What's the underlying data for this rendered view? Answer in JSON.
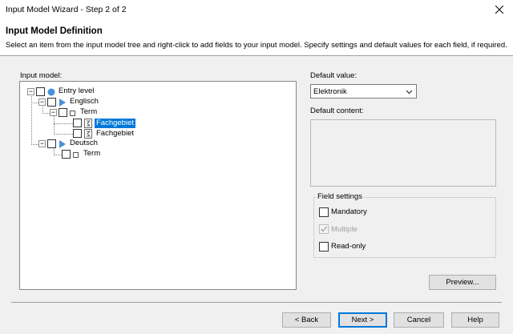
{
  "window": {
    "title": "Input Model Wizard - Step 2 of 2"
  },
  "header": {
    "title": "Input Model Definition",
    "description": "Select an item from the input model tree and right-click to add fields to your input model. Specify settings and default values for each field, if required."
  },
  "tree": {
    "label": "Input model:",
    "nodes": [
      {
        "label": "Entry level",
        "icon": "circle-icon",
        "selected": false
      },
      {
        "label": "Englisch",
        "icon": "triangle-icon",
        "selected": false
      },
      {
        "label": "Term",
        "icon": "square-icon",
        "selected": false
      },
      {
        "label": "Fachgebiet",
        "icon": "field-icon",
        "selected": true
      },
      {
        "label": "Fachgebiet",
        "icon": "field-icon",
        "selected": false
      },
      {
        "label": "Deutsch",
        "icon": "triangle-icon",
        "selected": false
      },
      {
        "label": "Term",
        "icon": "square-icon",
        "selected": false
      }
    ]
  },
  "default_value": {
    "label": "Default value:",
    "selected": "Elektronik"
  },
  "default_content": {
    "label": "Default content:",
    "value": ""
  },
  "field_settings": {
    "title": "Field settings",
    "mandatory": {
      "label": "Mandatory",
      "checked": false
    },
    "multiple": {
      "label": "Multiple",
      "checked": true,
      "disabled": true
    },
    "readonly": {
      "label": "Read-only",
      "checked": false
    }
  },
  "buttons": {
    "preview": "Preview...",
    "back": "< Back",
    "next": "Next >",
    "cancel": "Cancel",
    "help": "Help"
  },
  "colors": {
    "selection": "#0078d7",
    "accent_icon": "#4a90d9"
  }
}
